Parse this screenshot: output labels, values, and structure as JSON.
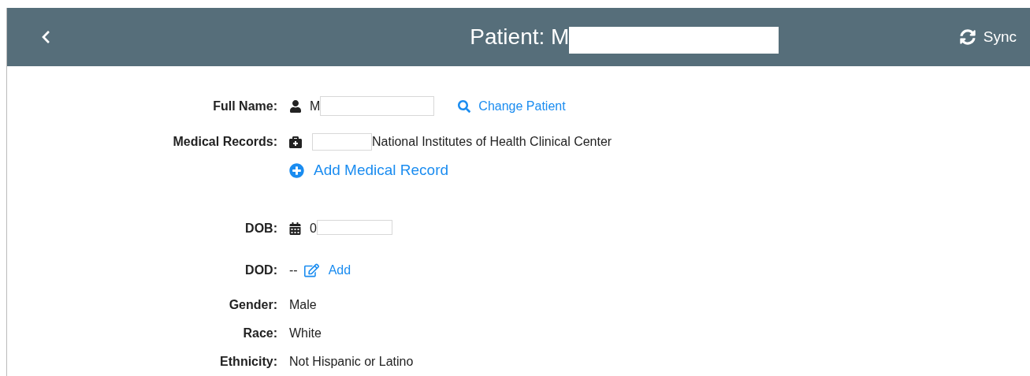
{
  "header": {
    "title": "Patient: M",
    "sync_label": "Sync"
  },
  "fields": [
    {
      "kind": "name",
      "label": "Full Name:",
      "value": "M",
      "action": "Change Patient"
    },
    {
      "kind": "records",
      "label": "Medical Records:",
      "value": "National Institutes of Health Clinical Center",
      "action": "Add Medical Record"
    },
    {
      "kind": "dob",
      "label": "DOB:",
      "value": "0"
    },
    {
      "kind": "dod",
      "label": "DOD:",
      "value": "--",
      "action": "Add"
    },
    {
      "kind": "text",
      "label": "Gender:",
      "value": "Male"
    },
    {
      "kind": "text",
      "label": "Race:",
      "value": "White"
    },
    {
      "kind": "text",
      "label": "Ethnicity:",
      "value": "Not Hispanic or Latino"
    }
  ]
}
